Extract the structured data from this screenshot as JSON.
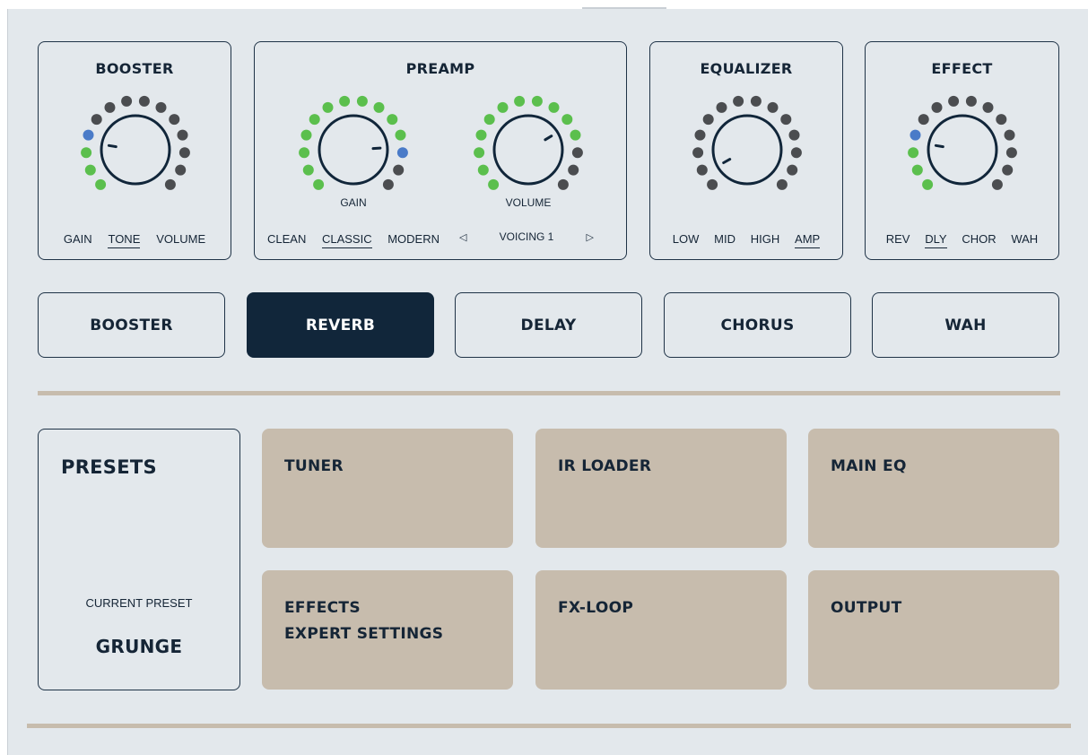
{
  "colors": {
    "background": "#e3e8ec",
    "dark_navy": "#11263a",
    "active_dot": "#5bbf4d",
    "inactive_dot": "#4b4d50",
    "indicator_dot": "#4a7bc8",
    "tile": "#c7bcad"
  },
  "booster": {
    "title": "BOOSTER",
    "knob": {
      "level": 0.2,
      "lit_dots": 3,
      "indicator_dot": 3
    },
    "tabs": [
      {
        "label": "GAIN",
        "active": false
      },
      {
        "label": "TONE",
        "active": true
      },
      {
        "label": "VOLUME",
        "active": false
      }
    ]
  },
  "preamp": {
    "title": "PREAMP",
    "gain_knob": {
      "label": "GAIN",
      "level": 0.82,
      "lit_dots": 11,
      "indicator_dot": 11
    },
    "volume_knob": {
      "label": "VOLUME",
      "level": 0.72,
      "lit_dots": 11,
      "indicator_dot": null
    },
    "tabs": [
      {
        "label": "CLEAN",
        "active": false
      },
      {
        "label": "CLASSIC",
        "active": true
      },
      {
        "label": "MODERN",
        "active": false
      }
    ],
    "voicing": {
      "prev_icon": "triangle-left",
      "label": "VOICING 1",
      "next_icon": "triangle-right"
    }
  },
  "equalizer": {
    "title": "EQUALIZER",
    "knob": {
      "level": 0.06,
      "lit_dots": 0,
      "indicator_dot": null
    },
    "tabs": [
      {
        "label": "LOW",
        "active": false
      },
      {
        "label": "MID",
        "active": false
      },
      {
        "label": "HIGH",
        "active": false
      },
      {
        "label": "AMP",
        "active": true
      }
    ]
  },
  "effect": {
    "title": "EFFECT",
    "knob": {
      "level": 0.2,
      "lit_dots": 3,
      "indicator_dot": 3
    },
    "tabs": [
      {
        "label": "REV",
        "active": false
      },
      {
        "label": "DLY",
        "active": true
      },
      {
        "label": "CHOR",
        "active": false
      },
      {
        "label": "WAH",
        "active": false
      }
    ]
  },
  "fx_buttons": [
    {
      "label": "BOOSTER",
      "active": false
    },
    {
      "label": "REVERB",
      "active": true
    },
    {
      "label": "DELAY",
      "active": false
    },
    {
      "label": "CHORUS",
      "active": false
    },
    {
      "label": "WAH",
      "active": false
    }
  ],
  "presets": {
    "title": "PRESETS",
    "current_label": "CURRENT PRESET",
    "current_name": "GRUNGE"
  },
  "tiles": [
    {
      "lines": [
        "TUNER"
      ]
    },
    {
      "lines": [
        "IR LOADER"
      ]
    },
    {
      "lines": [
        "MAIN EQ"
      ]
    },
    {
      "lines": [
        "EFFECTS",
        "EXPERT SETTINGS"
      ]
    },
    {
      "lines": [
        "FX-LOOP"
      ]
    },
    {
      "lines": [
        "OUTPUT"
      ]
    }
  ]
}
